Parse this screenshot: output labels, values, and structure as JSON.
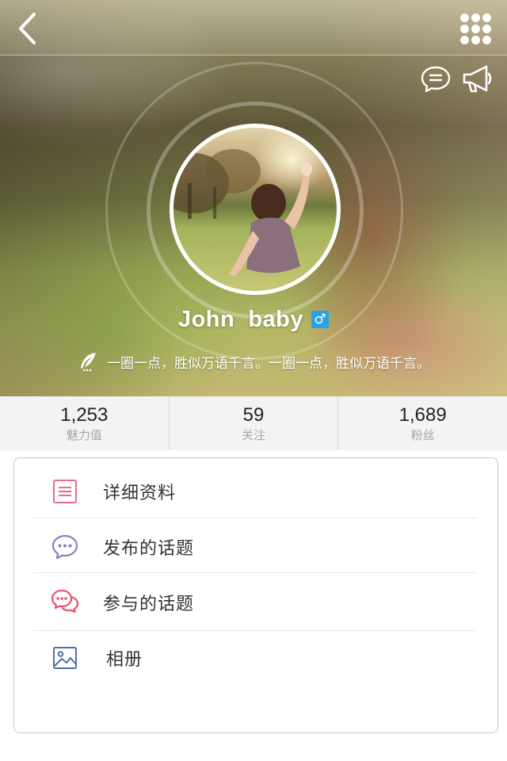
{
  "header": {
    "back_icon": "chevron-left-icon",
    "menu_icon": "grid-dots-icon",
    "chat_icon": "chat-bubble-icon",
    "announce_icon": "megaphone-icon"
  },
  "profile": {
    "username": "John  baby",
    "gender_symbol": "♂",
    "gender_color": "#27a4e8",
    "signature_icon": "feather-pen-icon",
    "signature": "一圈一点，胜似万语千言。一圈一点，胜似万语千言。"
  },
  "stats": [
    {
      "value": "1,253",
      "label": "魅力值"
    },
    {
      "value": "59",
      "label": "关注"
    },
    {
      "value": "1,689",
      "label": "粉丝"
    }
  ],
  "menu": [
    {
      "label": "详细资料",
      "icon": "document-list-icon",
      "color": "#e86b8a"
    },
    {
      "label": "发布的话题",
      "icon": "chat-dots-icon",
      "color": "#8d7fbf"
    },
    {
      "label": "参与的话题",
      "icon": "chat-multi-icon",
      "color": "#e8536a"
    },
    {
      "label": "相册",
      "icon": "image-icon",
      "color": "#4f6fa8"
    }
  ]
}
